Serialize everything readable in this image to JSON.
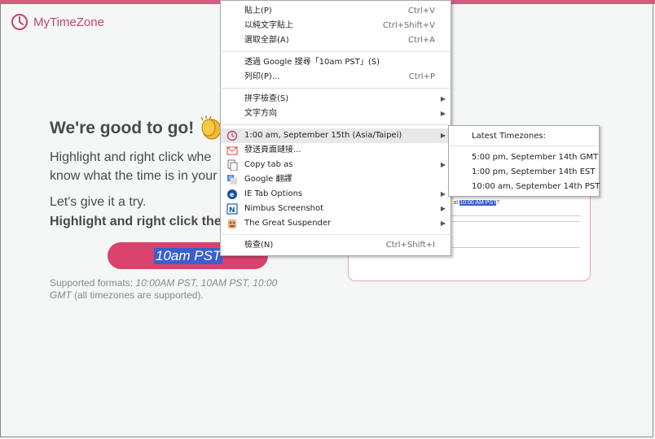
{
  "app": {
    "brand_name": "MyTimeZone",
    "accent": "#d25c7c"
  },
  "main": {
    "heading": "We're good to go!",
    "desc_line1": "Highlight and right click whe",
    "desc_line2": "know what the time is in your",
    "try_line1": "Let's give it a try.",
    "try_line2": "Highlight and right click the",
    "cta_text": "10am PST",
    "formats_prefix": "Supported formats: ",
    "formats_examples": "10:00AM PST, 10AM PST, 10:00 GMT",
    "formats_suffix": " (all timezones are supported)."
  },
  "demo": {
    "text_prefix": "k at ",
    "text_highlight": "10:00 AM PST",
    "text_suffix": "?"
  },
  "context_menu": {
    "paste": {
      "label": "貼上(P)",
      "shortcut": "Ctrl+V"
    },
    "paste_plain": {
      "label": "以純文字貼上",
      "shortcut": "Ctrl+Shift+V"
    },
    "select_all": {
      "label": "選取全部(A)",
      "shortcut": "Ctrl+A"
    },
    "search_google": {
      "label": "透過 Google 搜尋「10am PST」(S)"
    },
    "print": {
      "label": "列印(P)...",
      "shortcut": "Ctrl+P"
    },
    "spellcheck": {
      "label": "拼字檢查(S)"
    },
    "text_direction": {
      "label": "文字方向"
    },
    "mytimezone": {
      "label": "1:00 am, September 15th (Asia/Taipei)"
    },
    "send_link": {
      "label": "發送頁面鏈接..."
    },
    "copy_tab": {
      "label": "Copy tab as"
    },
    "google_translate": {
      "label": "Google 翻譯"
    },
    "ie_tab": {
      "label": "IE Tab Options"
    },
    "nimbus": {
      "label": "Nimbus Screenshot"
    },
    "suspender": {
      "label": "The Great Suspender"
    },
    "inspect": {
      "label": "檢查(N)",
      "shortcut": "Ctrl+Shift+I"
    }
  },
  "submenu": {
    "header": "Latest Timezones:",
    "items": [
      "5:00 pm, September 14th GMT",
      "1:00 pm, September 14th EST",
      "10:00 am, September 14th PST"
    ]
  }
}
